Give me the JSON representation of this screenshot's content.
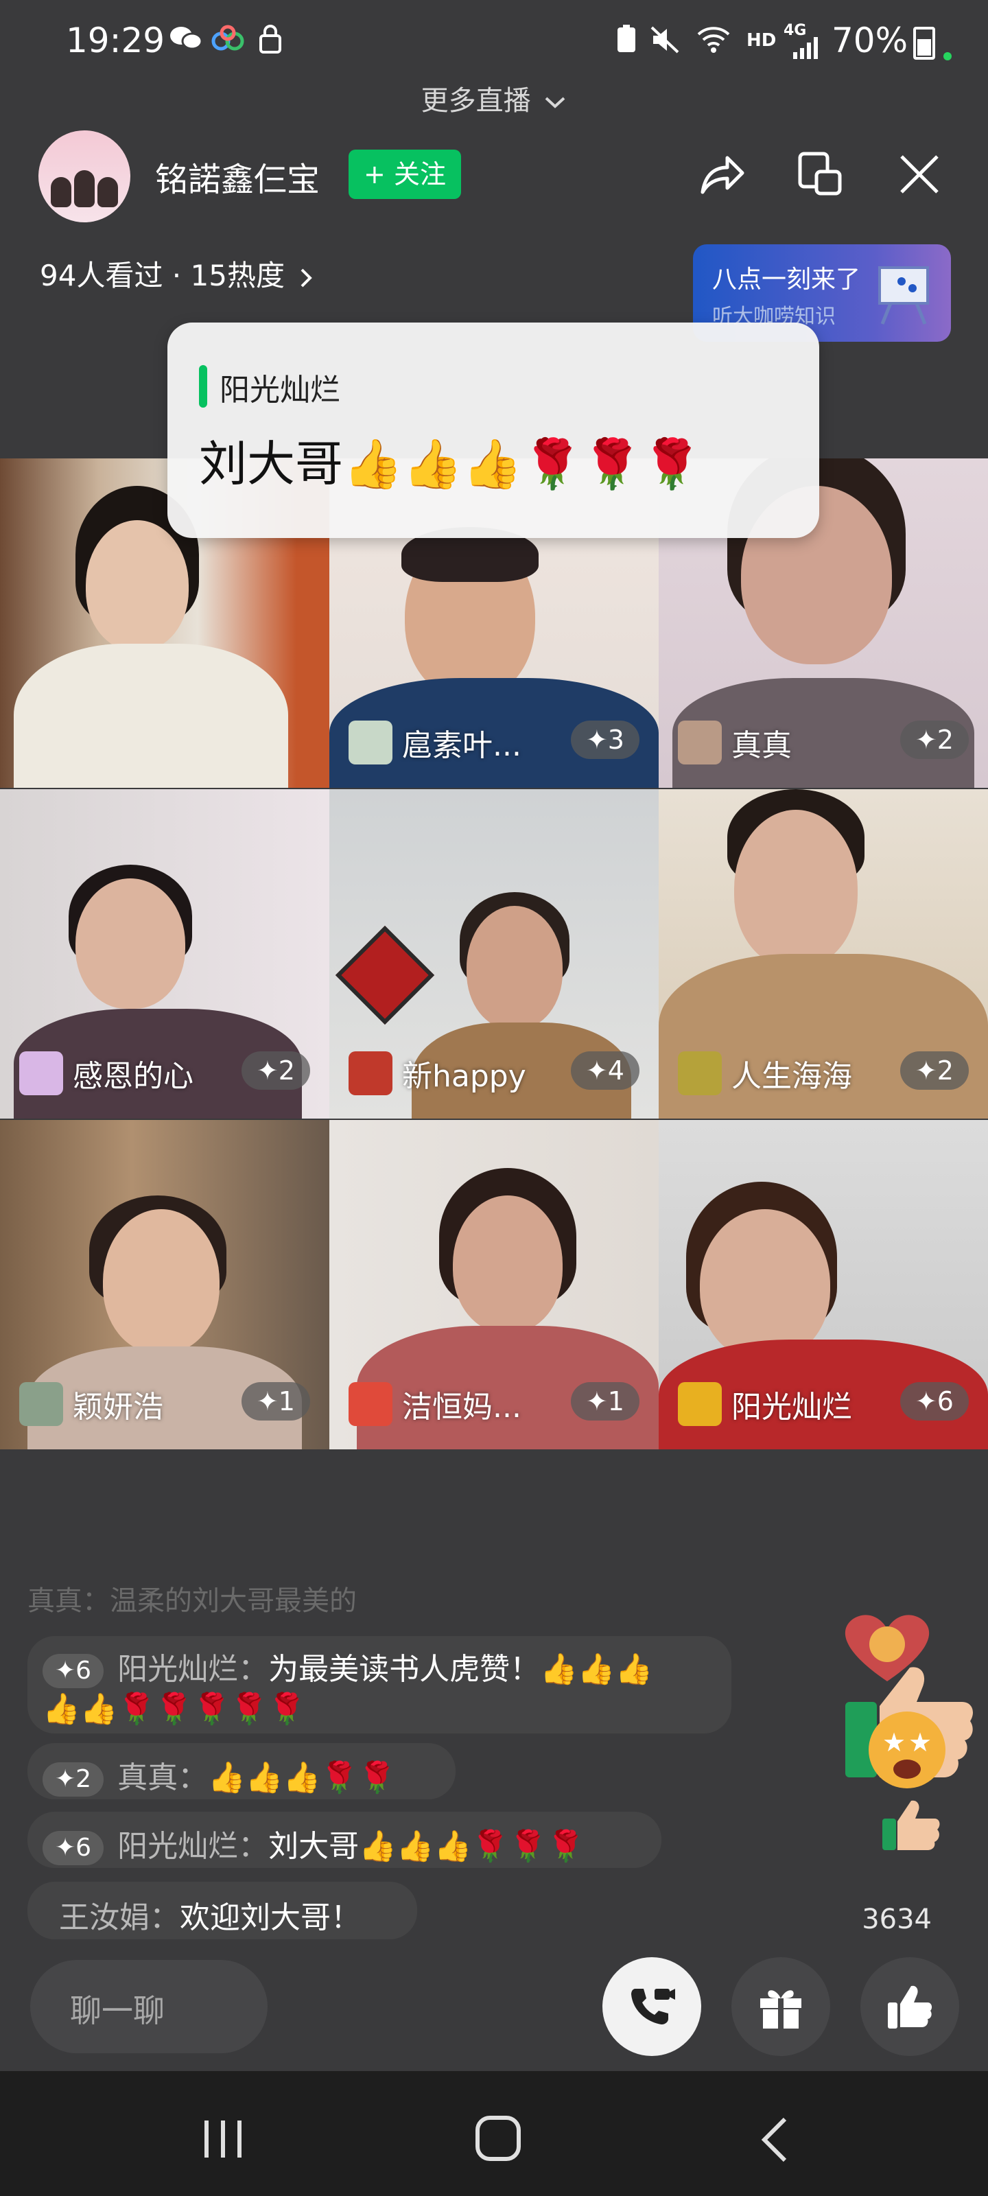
{
  "status_bar": {
    "time": "19:29",
    "network": "HD",
    "signal": "4G",
    "battery": "70%"
  },
  "header": {
    "more_live": "更多直播",
    "host_name": "铭諾鑫仨宝",
    "follow_label": "+ 关注",
    "viewers": "94人看过 · 15热度"
  },
  "promo": {
    "title": "八点一刻来了",
    "subtitle": "听大咖唠知识"
  },
  "popup": {
    "sender": "阳光灿烂",
    "message": "刘大哥👍👍👍🌹🌹🌹"
  },
  "participants": [
    {
      "name": "",
      "count": ""
    },
    {
      "name": "扈素叶...",
      "count": "✦3"
    },
    {
      "name": "真真",
      "count": "✦2"
    },
    {
      "name": "感恩的心",
      "count": "✦2"
    },
    {
      "name": "新happy",
      "count": "✦4"
    },
    {
      "name": "人生海海",
      "count": "✦2"
    },
    {
      "name": "颖妍浩",
      "count": "✦1"
    },
    {
      "name": "洁恒妈...",
      "count": "✦1"
    },
    {
      "name": "阳光灿烂",
      "count": "✦6"
    }
  ],
  "comments": [
    {
      "badge": "✦6",
      "name": "阳光灿烂：",
      "text": "为最美读书人虎赞！👍👍👍",
      "line2": "👍👍🌹🌹🌹🌹🌹"
    },
    {
      "badge": "✦2",
      "name": "真真：",
      "text": "👍👍👍🌹🌹"
    },
    {
      "badge": "✦6",
      "name": "阳光灿烂：",
      "text": "刘大哥👍👍👍🌹🌹🌹"
    },
    {
      "badge": "",
      "name": "王汝娟：",
      "text": "欢迎刘大哥！"
    }
  ],
  "faded_comment": "真真：温柔的刘大哥最美的",
  "likes_count": "3634",
  "chat_placeholder": "聊一聊",
  "colors": {
    "accent_green": "#07c160",
    "background": "#3a3a3c"
  }
}
